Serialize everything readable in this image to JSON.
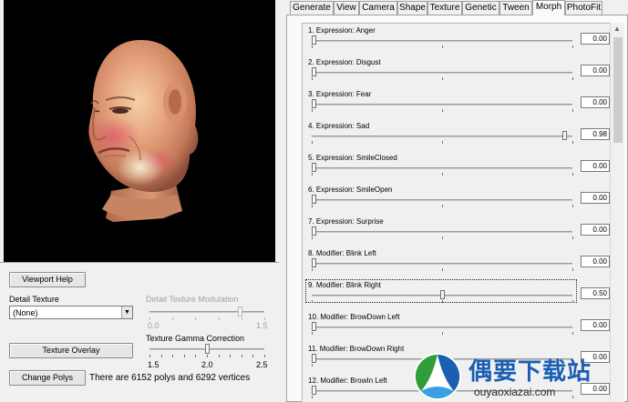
{
  "viewport_help_label": "Viewport Help",
  "detail_texture": {
    "label": "Detail Texture",
    "selected": "(None)"
  },
  "detail_modulation": {
    "label": "Detail Texture Modulation",
    "min": "0.0",
    "max": "1.5",
    "value": 1.2,
    "range": [
      0.0,
      1.5
    ],
    "enabled": false
  },
  "texture_overlay_label": "Texture Overlay",
  "gamma": {
    "label": "Texture Gamma Correction",
    "min": "1.5",
    "mid": "2.0",
    "max": "2.5",
    "value": 2.0,
    "range": [
      1.5,
      2.5
    ]
  },
  "change_polys_label": "Change Polys",
  "poly_info": "There are 6152 polys and 6292 vertices",
  "tabs": [
    {
      "label": "Generate"
    },
    {
      "label": "View"
    },
    {
      "label": "Camera"
    },
    {
      "label": "Shape"
    },
    {
      "label": "Texture"
    },
    {
      "label": "Genetic"
    },
    {
      "label": "Tween"
    },
    {
      "label": "Morph",
      "active": true
    },
    {
      "label": "PhotoFit"
    }
  ],
  "morphs": [
    {
      "label": "1.  Expression: Anger",
      "value": "0.00",
      "level": 0.0
    },
    {
      "label": "2.  Expression: Disgust",
      "value": "0.00",
      "level": 0.0
    },
    {
      "label": "3.  Expression: Fear",
      "value": "0.00",
      "level": 0.0
    },
    {
      "label": "4.  Expression: Sad",
      "value": "0.98",
      "level": 0.98
    },
    {
      "label": "5.  Expression: SmileClosed",
      "value": "0.00",
      "level": 0.0
    },
    {
      "label": "6.  Expression: SmileOpen",
      "value": "0.00",
      "level": 0.0
    },
    {
      "label": "7.  Expression: Surprise",
      "value": "0.00",
      "level": 0.0
    },
    {
      "label": "8.  Modifier: Blink Left",
      "value": "0.00",
      "level": 0.0
    },
    {
      "label": "9.  Modifier: Blink Right",
      "value": "0.50",
      "level": 0.5,
      "focused": true
    },
    {
      "label": "10.  Modifier: BrowDown Left",
      "value": "0.00",
      "level": 0.0
    },
    {
      "label": "11.  Modifier: BrowDown Right",
      "value": "0.00",
      "level": 0.0
    },
    {
      "label": "12.  Modifier: BrowIn Left",
      "value": "0.00",
      "level": 0.0
    }
  ],
  "watermark": {
    "name": "偶要下载站",
    "url": "ouyaoxiazai.com"
  },
  "colors": {
    "viewport_bg": "#000000",
    "watermark_blue": "#1a5fb4",
    "watermark_green": "#2f9e3a"
  }
}
